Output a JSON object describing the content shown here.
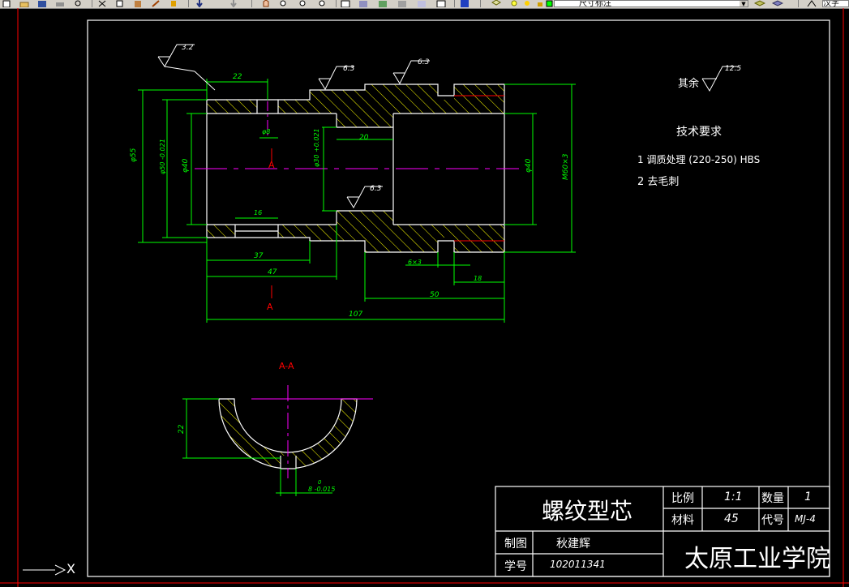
{
  "toolbar": {
    "icons": [
      "new-icon",
      "open-icon",
      "save-icon",
      "print-icon",
      "preview-icon",
      "cut-icon",
      "copy-icon",
      "paste-icon",
      "match-icon",
      "brush-icon",
      "undo-icon",
      "redo-icon",
      "pan-icon",
      "zoom-realtime-icon",
      "zoom-window-icon",
      "zoom-prev-icon",
      "properties-icon",
      "design-center-icon",
      "tool-palette-icon",
      "sheet-set-icon",
      "markup-icon",
      "calc-icon",
      "help-icon",
      "layer-manager-icon",
      "layer-state-icon"
    ],
    "layer_value": "尺寸标注",
    "style_value": "汉字"
  },
  "drawing": {
    "roughness_marks": [
      "3.2",
      "6.3",
      "6.3",
      "6.3"
    ],
    "roughness_other_label": "其余",
    "roughness_other_value": "12.5",
    "tech_title": "技术要求",
    "tech_items": [
      "1 调质处理 (220-250) HBS",
      "2 去毛刺"
    ],
    "dims": {
      "d22_top": "22",
      "d8": "φ8",
      "d20": "20",
      "d16": "16",
      "d37": "37",
      "d47": "47",
      "d107": "107",
      "d50": "50",
      "d18": "18",
      "d6x3": "6×3",
      "d55": "φ55",
      "d50tol": "φ50 -0.021",
      "d40_left": "φ40",
      "d30": "φ30 +0.021",
      "d40_right": "φ40",
      "m60": "M60×3",
      "d22_section": "22",
      "d8tol": "8 -0.015",
      "tol_zero": "0"
    },
    "section_letter": "A",
    "section_label": "A-A"
  },
  "title_block": {
    "part_name": "螺纹型芯",
    "scale_label": "比例",
    "scale_value": "1:1",
    "qty_label": "数量",
    "qty_value": "1",
    "material_label": "材料",
    "material_value": "45",
    "code_label": "代号",
    "code_value": "MJ-4",
    "drawn_label": "制图",
    "drawn_value": "秋建辉",
    "id_label": "学号",
    "id_value": "102011341",
    "school": "太原工业学院"
  },
  "ucs": {
    "axis_x": "X"
  },
  "colors": {
    "background": "#000000",
    "frame": "#ffffff",
    "border_red": "#ff0000",
    "geometry": "#ffffff",
    "dimension": "#00ff00",
    "hatch": "#ffff00",
    "centerline": "#ff00ff",
    "section": "#ff0000"
  }
}
